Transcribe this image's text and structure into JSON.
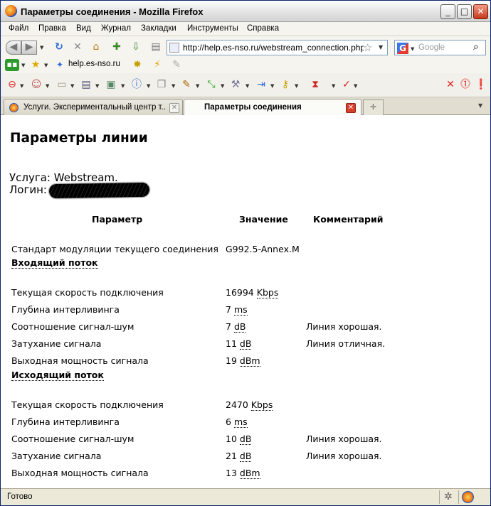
{
  "window": {
    "title": "Параметры соединения - Mozilla Firefox"
  },
  "menu": [
    "Файл",
    "Правка",
    "Вид",
    "Журнал",
    "Закладки",
    "Инструменты",
    "Справка"
  ],
  "nav": {
    "url": "http://help.es-nso.ru/webstream_connection.php?us=",
    "search_placeholder": "Google",
    "search_engine_icon": "G"
  },
  "bookmarks": {
    "item_label": "help.es-nso.ru"
  },
  "tabs": [
    {
      "label": "Услуги. Экспериментальный центр т...",
      "active": false
    },
    {
      "label": "Параметры соединения",
      "active": true
    }
  ],
  "page": {
    "title": "Параметры линии",
    "service_label": "Услуга: Webstream.",
    "login_label": "Логин:",
    "columns": [
      "Параметр",
      "Значение",
      "Комментарий"
    ],
    "modulation_label": "Стандарт модуляции текущего соединения",
    "modulation_value": "G992.5-Annex.M",
    "downstream": {
      "heading": "Входящий поток",
      "rows": [
        {
          "param": "Текущая скорость подключения",
          "num": "16994",
          "unit": "Kbps",
          "comment": ""
        },
        {
          "param": "Глубина интерливинга",
          "num": "7",
          "unit": "ms",
          "comment": ""
        },
        {
          "param": "Соотношение сигнал-шум",
          "num": "7",
          "unit": "dB",
          "comment": "Линия хорошая."
        },
        {
          "param": "Затухание сигнала",
          "num": "11",
          "unit": "dB",
          "comment": "Линия отличная."
        },
        {
          "param": "Выходная мощность сигнала",
          "num": "19",
          "unit": "dBm",
          "comment": ""
        }
      ]
    },
    "upstream": {
      "heading": "Исходящий поток",
      "rows": [
        {
          "param": "Текущая скорость подключения",
          "num": "2470",
          "unit": "Kbps",
          "comment": ""
        },
        {
          "param": "Глубина интерливинга",
          "num": "6",
          "unit": "ms",
          "comment": ""
        },
        {
          "param": "Соотношение сигнал-шум",
          "num": "10",
          "unit": "dB",
          "comment": "Линия хорошая."
        },
        {
          "param": "Затухание сигнала",
          "num": "21",
          "unit": "dB",
          "comment": "Линия хорошая."
        },
        {
          "param": "Выходная мощность сигнала",
          "num": "13",
          "unit": "dBm",
          "comment": ""
        }
      ]
    }
  },
  "status": {
    "text": "Готово"
  }
}
